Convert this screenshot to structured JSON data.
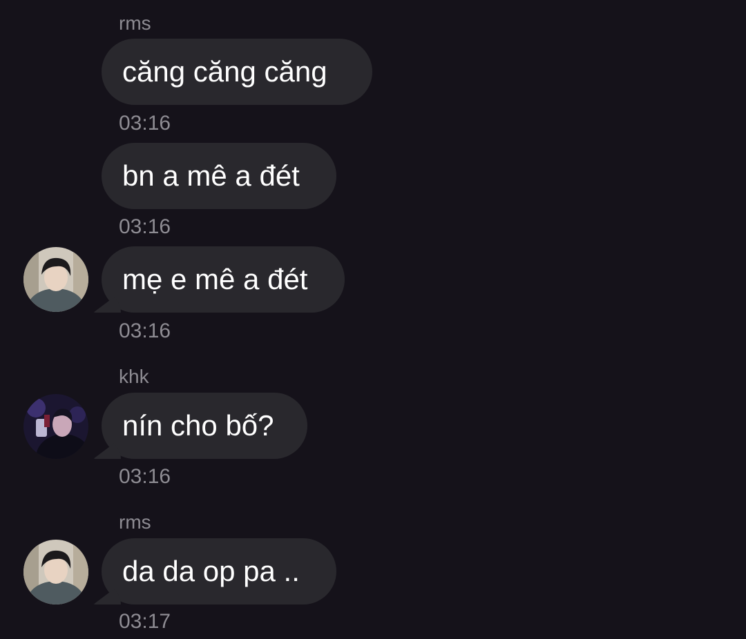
{
  "messages": [
    {
      "sender": "rms",
      "text": "căng căng căng",
      "time": "03:16",
      "avatar": ""
    },
    {
      "sender": "",
      "text": "bn a mê a đét",
      "time": "03:16",
      "avatar": ""
    },
    {
      "sender": "",
      "text": "mẹ e mê a đét",
      "time": "03:16",
      "avatar": "avatar-rms-icon"
    },
    {
      "sender": "khk",
      "text": "nín cho bố?",
      "time": "03:16",
      "avatar": "avatar-khk-icon"
    },
    {
      "sender": "rms",
      "text": "da da op pa ..",
      "time": "03:17",
      "avatar": "avatar-rms-icon"
    }
  ],
  "colors": {
    "background": "#15121a",
    "bubble": "#29282d",
    "text": "#ffffff",
    "meta": "#8e8c93"
  }
}
